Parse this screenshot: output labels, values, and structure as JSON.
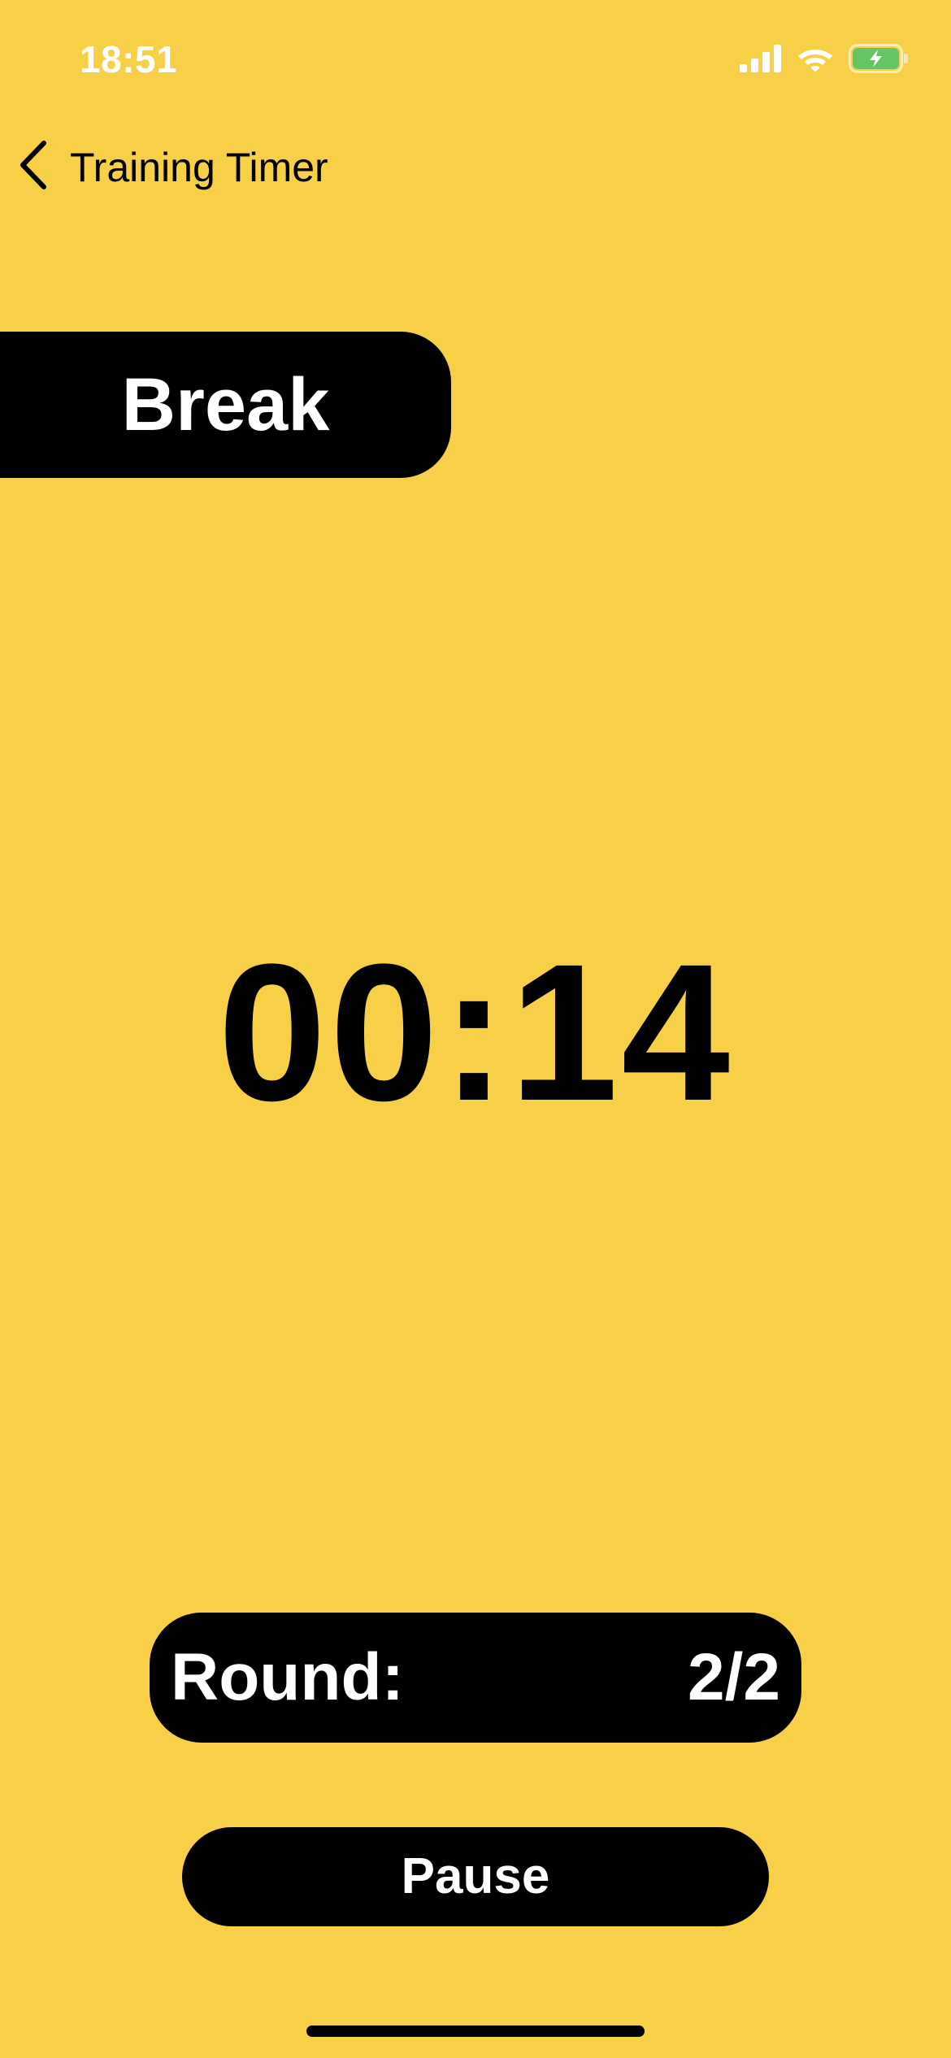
{
  "status_bar": {
    "time": "18:51",
    "icons": [
      "cellular-signal-icon",
      "wifi-icon",
      "battery-charging-icon"
    ],
    "battery_color": "#65C466"
  },
  "nav": {
    "back_icon": "chevron-left-icon",
    "title": "Training Timer"
  },
  "phase": {
    "label": "Break"
  },
  "timer": {
    "display": "00:14"
  },
  "round": {
    "label": "Round:",
    "value": "2/2"
  },
  "controls": {
    "pause_label": "Pause"
  },
  "colors": {
    "background": "#F8D048",
    "accent": "#000000",
    "text_on_accent": "#FFFFFF"
  }
}
